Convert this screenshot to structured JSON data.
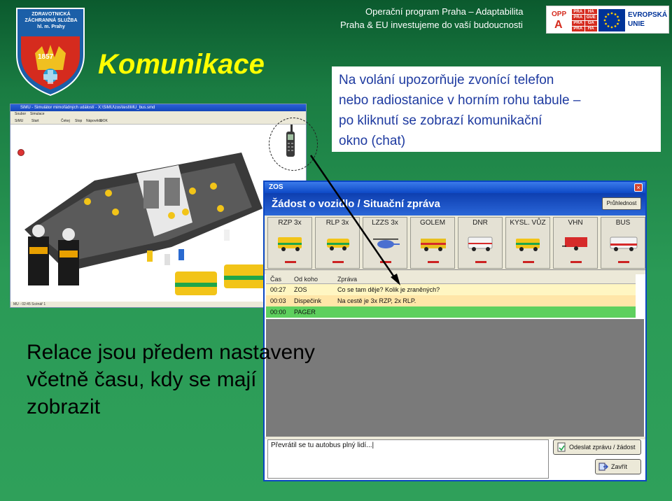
{
  "header": {
    "line1": "Operační program Praha – Adaptabilita",
    "line2": "Praha & EU investujeme do vaší budoucnosti",
    "opp_label": "OPP",
    "opp_letter": "A",
    "praha_cells": [
      "PRA",
      "HA",
      "PRA",
      "GUE",
      "PRA",
      "GA",
      "PRA",
      "HA"
    ],
    "eu_label": "EVROPSKÁ\nUNIE"
  },
  "logo": {
    "text": "ZDRAVOTNICKÁ\nZÁCHRANNÁ SLUŽBA\nhl. m. Prahy",
    "year": "1857"
  },
  "title": "Komunikace",
  "callout": "Na volání upozorňuje zvonící telefon\nnebo radiostanice v horním rohu tabule –\npo kliknutí se zobrazí komunikační\nokno (chat)",
  "game_window": {
    "title": "SiMU - Simulátor mimořádných událostí - X:\\SiMU\\zos\\test\\MU_bus.smd",
    "menu": [
      "Soubor",
      "Simulace"
    ],
    "toolbar": [
      "SiMU",
      "Start",
      "Čekej",
      "Stop",
      "Nápověda",
      "DOK"
    ],
    "status": "MU - 02:45  Scénář 1"
  },
  "chat_window": {
    "title": "ZOS",
    "heading": "Žádost o vozidlo / Situační zpráva",
    "preview_button": "Průhlednost",
    "vehicles": [
      {
        "label": "RZP 3x",
        "color": "#f2c418"
      },
      {
        "label": "RLP 3x",
        "color": "#f2c418"
      },
      {
        "label": "LZZS 3x",
        "color": "#4a6fd0"
      },
      {
        "label": "GOLEM",
        "color": "#e8c020"
      },
      {
        "label": "DNR",
        "color": "#f0f0f0"
      },
      {
        "label": "KYSL. VŮZ",
        "color": "#f2c418"
      },
      {
        "label": "VHN",
        "color": "#d62a2a"
      },
      {
        "label": "BUS",
        "color": "#d62a2a"
      }
    ],
    "columns": [
      "Čas",
      "Od koho",
      "Zpráva"
    ],
    "messages": [
      {
        "time": "00:27",
        "from": "ZOS",
        "text": "Co se tam děje? Kolik je zraněných?",
        "bg": "#fff6c2"
      },
      {
        "time": "00:03",
        "from": "Dispečink",
        "text": "Na cestě je 3x RZP, 2x RLP.",
        "bg": "#ffe6a8"
      },
      {
        "time": "00:00",
        "from": "PAGER",
        "text": "",
        "bg": "#5ed05e"
      }
    ],
    "input_value": "Převrátil se tu autobus plný lidí...|",
    "send_button": "Odeslat zprávu / žádost",
    "close_button": "Zavřít"
  },
  "bottom_text": "Relace jsou předem nastaveny\nvčetně času, kdy se mají\nzobrazit"
}
